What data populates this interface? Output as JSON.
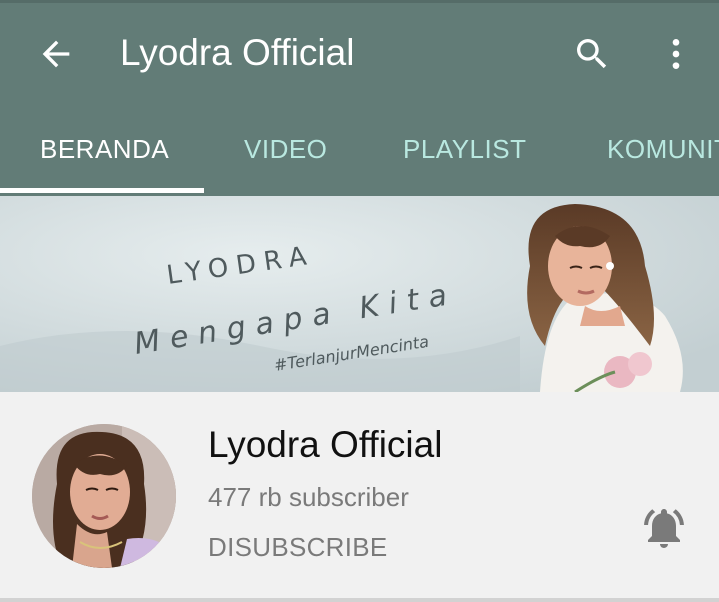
{
  "app_bar": {
    "title": "Lyodra Official",
    "back_icon": "arrow-back-icon",
    "search_icon": "search-icon",
    "more_icon": "more-vert-icon",
    "color": "#627c77"
  },
  "tabs": [
    {
      "label": "BERANDA",
      "active": true
    },
    {
      "label": "VIDEO",
      "active": false
    },
    {
      "label": "PLAYLIST",
      "active": false
    },
    {
      "label": "KOMUNITAS",
      "active": false
    }
  ],
  "banner": {
    "artist": "LYODRA",
    "song": "Mengapa Kita",
    "hashtag": "#TerlanjurMencinta"
  },
  "channel": {
    "name": "Lyodra Official",
    "subscribers": "477 rb subscriber",
    "subscribe_label": "DISUBSCRIBE",
    "notification_icon": "bell-ringing-icon"
  },
  "colors": {
    "tab_active": "#ffffff",
    "tab_inactive": "#b9e8e0",
    "secondary_text": "#7a7a7a"
  }
}
